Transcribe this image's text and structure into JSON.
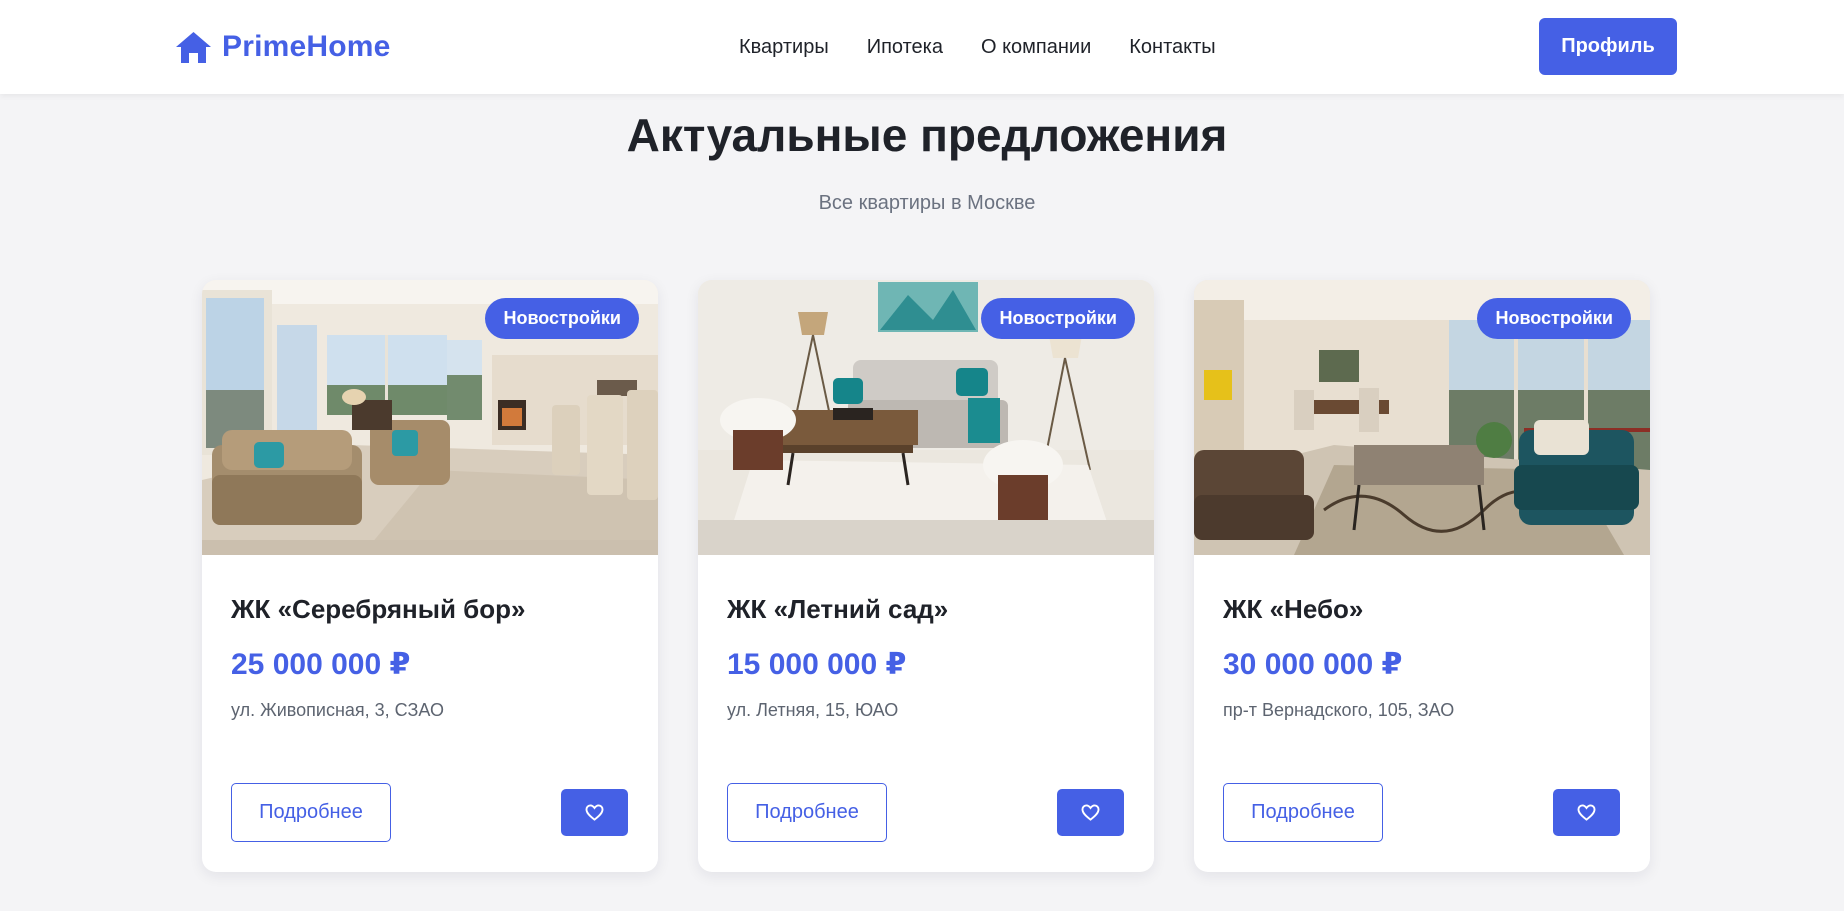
{
  "brand": {
    "name": "PrimeHome",
    "accent_color": "#4560e5",
    "logo_icon": "house-icon"
  },
  "nav": {
    "items": [
      "Квартиры",
      "Ипотека",
      "О компании",
      "Контакты"
    ]
  },
  "header": {
    "profile_label": "Профиль"
  },
  "section": {
    "title": "Актуальные предложения",
    "subtitle": "Все квартиры в Москве"
  },
  "cards": [
    {
      "badge": "Новостройки",
      "title": "ЖК «Серебряный бор»",
      "price": "25 000 000 ₽",
      "address": "ул. Живописная, 3, СЗАО",
      "details_label": "Подробнее",
      "favorite_icon": "heart-icon",
      "image": "living-room-with-windows"
    },
    {
      "badge": "Новостройки",
      "title": "ЖК «Летний сад»",
      "price": "15 000 000 ₽",
      "address": "ул. Летняя, 15, ЮАО",
      "details_label": "Подробнее",
      "favorite_icon": "heart-icon",
      "image": "living-room-with-sofa"
    },
    {
      "badge": "Новостройки",
      "title": "ЖК «Небо»",
      "price": "30 000 000 ₽",
      "address": "пр-т Вернадского, 105, ЗАО",
      "details_label": "Подробнее",
      "favorite_icon": "heart-icon",
      "image": "open-plan-living-room"
    }
  ]
}
